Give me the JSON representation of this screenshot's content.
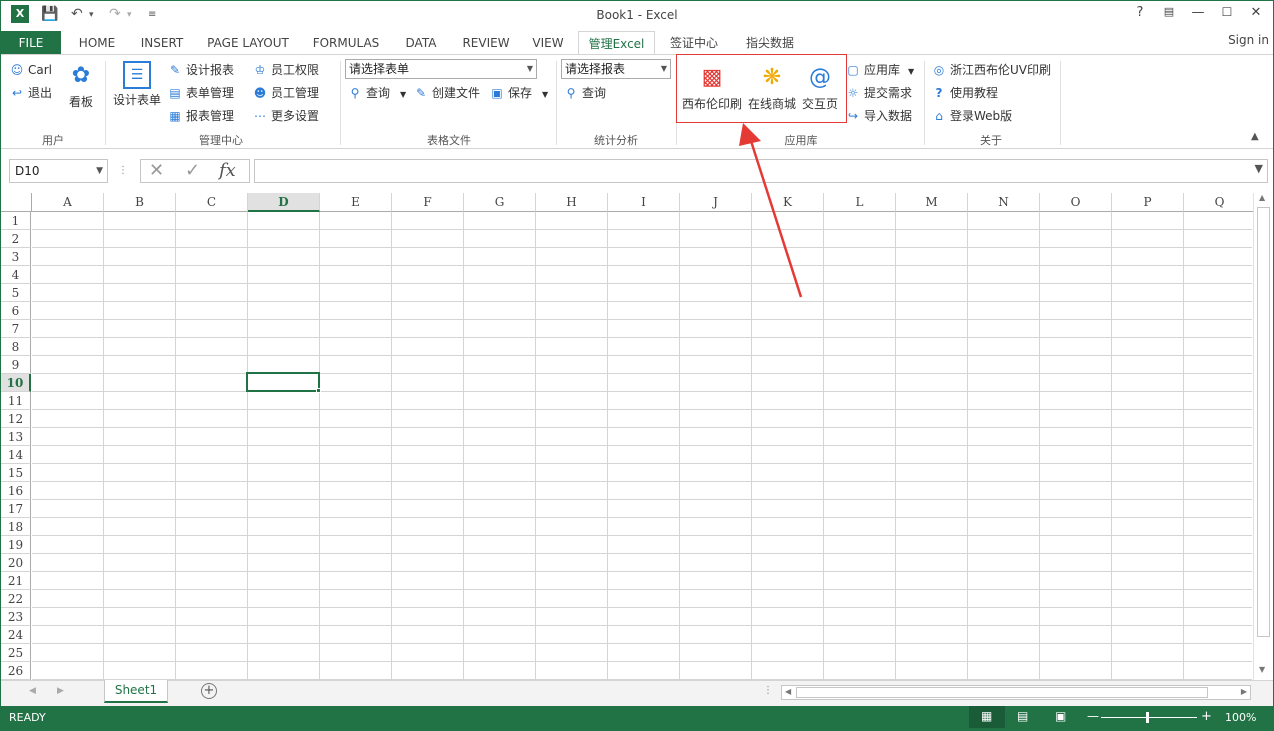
{
  "window": {
    "title": "Book1 - Excel",
    "help": "?",
    "signin": "Sign in"
  },
  "tabs": [
    {
      "label": "FILE"
    },
    {
      "label": "HOME"
    },
    {
      "label": "INSERT"
    },
    {
      "label": "PAGE LAYOUT"
    },
    {
      "label": "FORMULAS"
    },
    {
      "label": "DATA"
    },
    {
      "label": "REVIEW"
    },
    {
      "label": "VIEW"
    },
    {
      "label": "管理Excel"
    },
    {
      "label": "签证中心"
    },
    {
      "label": "指尖数据"
    }
  ],
  "ribbon": {
    "user": {
      "name": "Carl",
      "logout": "退出",
      "kanban": "看板",
      "group": "用户"
    },
    "manage": {
      "design_form": "设计表单",
      "design_report": "设计报表",
      "form_manage": "表单管理",
      "report_manage": "报表管理",
      "staff_perm": "员工权限",
      "staff_manage": "员工管理",
      "more_settings": "更多设置",
      "group": "管理中心"
    },
    "file": {
      "select_form": "请选择表单",
      "query": "查询",
      "create_file": "创建文件",
      "save": "保存",
      "group": "表格文件"
    },
    "stats": {
      "select_report": "请选择报表",
      "query": "查询",
      "group": "统计分析"
    },
    "apps": {
      "print": "西布伦印刷",
      "mall": "在线商城",
      "interact": "交互页",
      "app_store": "应用库",
      "submit": "提交需求",
      "import": "导入数据",
      "group": "应用库"
    },
    "about": {
      "uv": "浙江西布伦UV印刷",
      "tutorial": "使用教程",
      "web": "登录Web版",
      "group": "关于"
    }
  },
  "formula_bar": {
    "namebox": "D10",
    "fx": "fx",
    "formula": ""
  },
  "grid": {
    "columns": [
      "A",
      "B",
      "C",
      "D",
      "E",
      "F",
      "G",
      "H",
      "I",
      "J",
      "K",
      "L",
      "M",
      "N",
      "O",
      "P",
      "Q"
    ],
    "rows": [
      "1",
      "2",
      "3",
      "4",
      "5",
      "6",
      "7",
      "8",
      "9",
      "10",
      "11",
      "12",
      "13",
      "14",
      "15",
      "16",
      "17",
      "18",
      "19",
      "20",
      "21",
      "22",
      "23",
      "24",
      "25",
      "26"
    ],
    "selected_cell": "D10"
  },
  "sheets": [
    {
      "name": "Sheet1"
    }
  ],
  "status": {
    "ready": "READY",
    "zoom": "100%"
  },
  "colors": {
    "accent": "#217346",
    "highlight": "#e53935",
    "arrow": "#e53935"
  }
}
